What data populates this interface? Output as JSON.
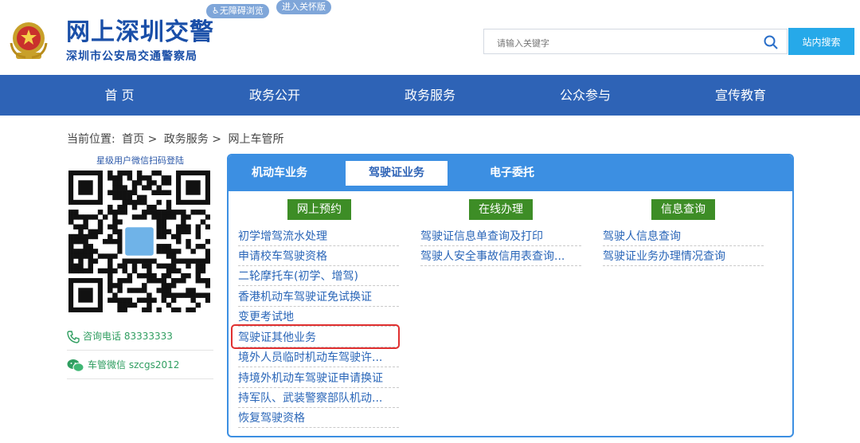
{
  "header": {
    "site_title": "网上深圳交警",
    "site_subtitle": "深圳市公安局交通警察局",
    "accessibility_label": "♿无障碍浏览",
    "care_mode_label": "进入关怀版",
    "search_placeholder": "请输入关键字",
    "search_button": "站内搜索"
  },
  "nav": [
    "首 页",
    "政务公开",
    "政务服务",
    "公众参与",
    "宣传教育"
  ],
  "breadcrumb": {
    "prefix": "当前位置:",
    "items": [
      "首页 >",
      "政务服务 >",
      "网上车管所"
    ]
  },
  "sidebar": {
    "qr_caption": "星级用户微信扫码登陆",
    "phone": "咨询电话 83333333",
    "wechat": "车管微信 szcgs2012"
  },
  "tabs": {
    "items": [
      "机动车业务",
      "驾驶证业务",
      "电子委托"
    ],
    "active": "驾驶证业务"
  },
  "columns": [
    {
      "title": "网上预约",
      "links": [
        "初学增驾流水处理",
        "申请校车驾驶资格",
        "二轮摩托车(初学、增驾)",
        "香港机动车驾驶证免试换证",
        "变更考试地",
        "驾驶证其他业务",
        "境外人员临时机动车驾驶许...",
        "持境外机动车驾驶证申请换证",
        "持军队、武装警察部队机动...",
        "恢复驾驶资格"
      ]
    },
    {
      "title": "在线办理",
      "links": [
        "驾驶证信息单查询及打印",
        "驾驶人安全事故信用表查询..."
      ]
    },
    {
      "title": "信息查询",
      "links": [
        "驾驶人信息查询",
        "驾驶证业务办理情况查询"
      ]
    }
  ],
  "highlighted_link": "驾驶证其他业务",
  "colors": {
    "nav": "#2e63b6",
    "tab_bar": "#3c8fe2",
    "column_head": "#3d8d26",
    "search_button": "#26a9e9",
    "highlight": "#e03030"
  }
}
